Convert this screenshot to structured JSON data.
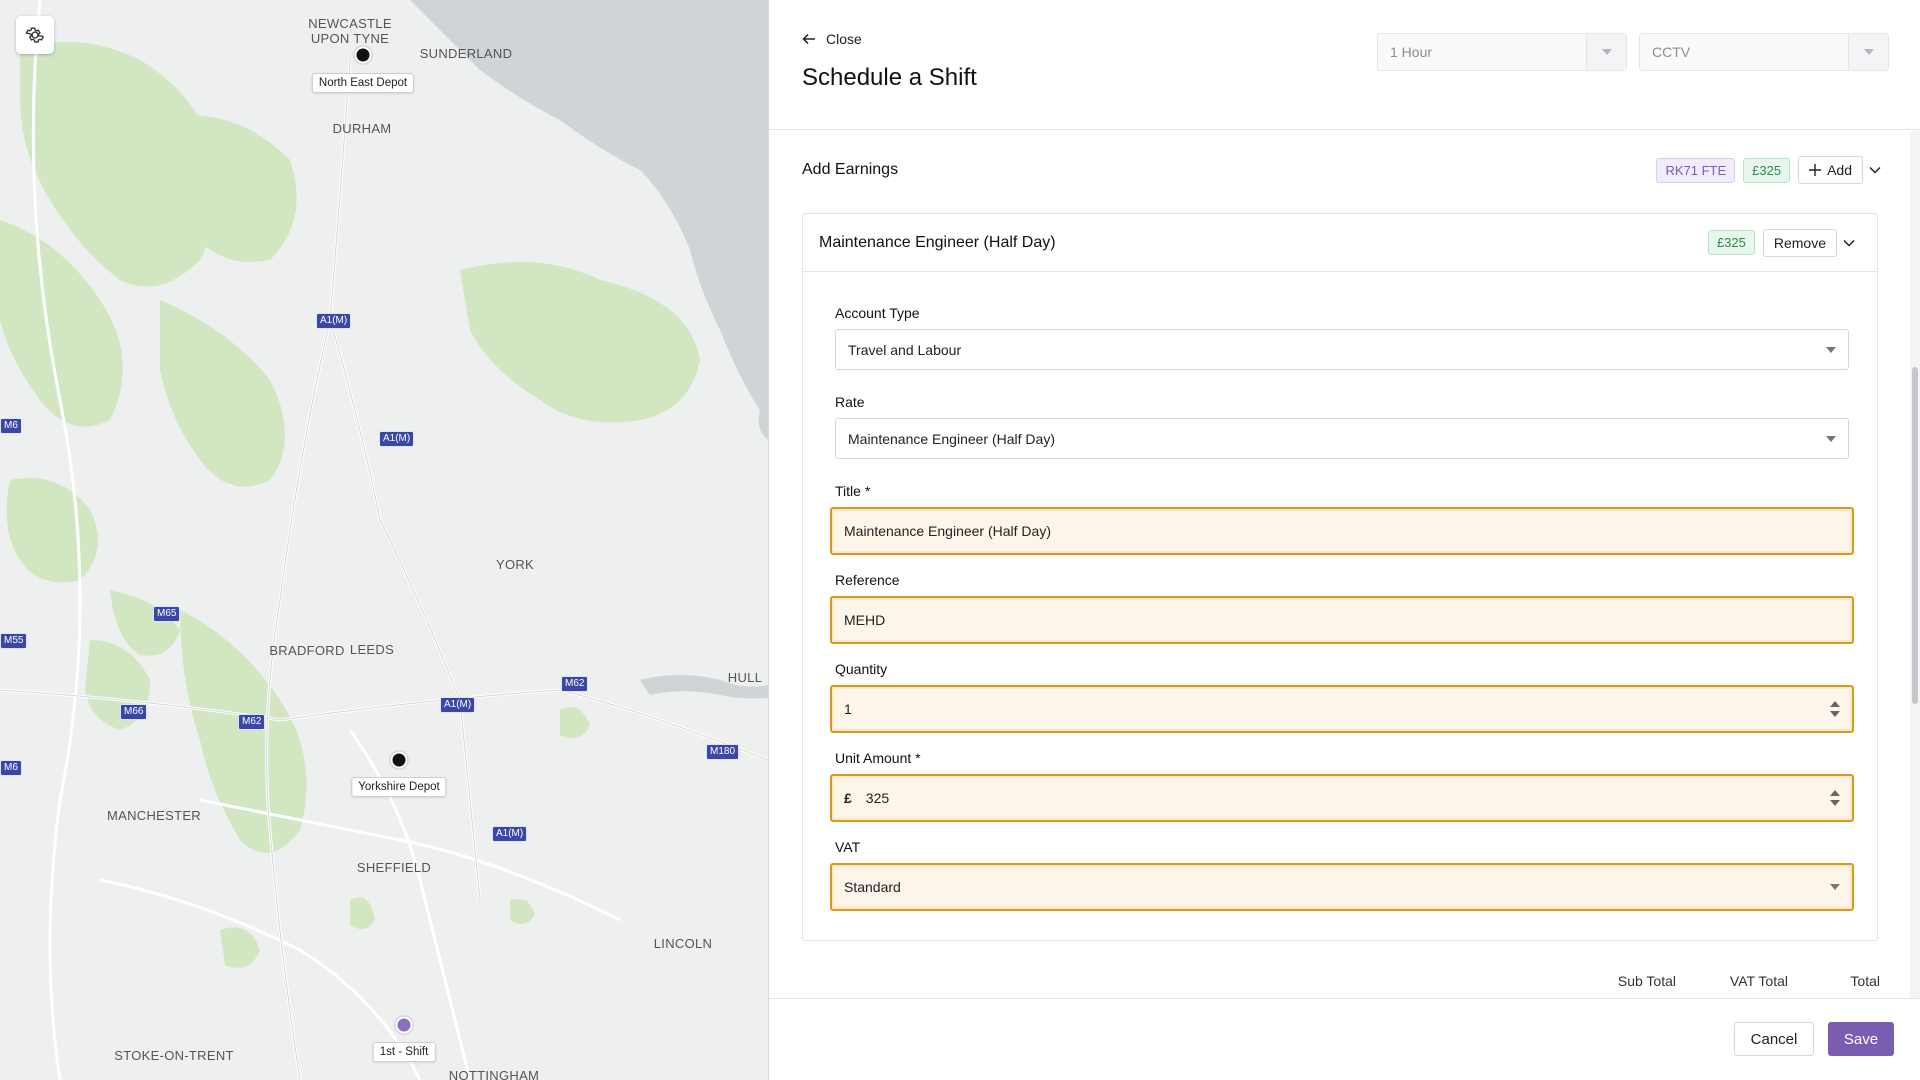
{
  "map": {
    "cities": [
      {
        "id": "newcastle",
        "label": "NEWCASTLE\nUPON TYNE"
      },
      {
        "id": "sunderland",
        "label": "SUNDERLAND"
      },
      {
        "id": "durham",
        "label": "DURHAM"
      },
      {
        "id": "york",
        "label": "YORK"
      },
      {
        "id": "bradford",
        "label": "BRADFORD"
      },
      {
        "id": "leeds",
        "label": "LEEDS"
      },
      {
        "id": "hull",
        "label": "HULL"
      },
      {
        "id": "manchester",
        "label": "MANCHESTER"
      },
      {
        "id": "sheffield",
        "label": "SHEFFIELD"
      },
      {
        "id": "lincoln",
        "label": "LINCOLN"
      },
      {
        "id": "stoke",
        "label": "STOKE-ON-TRENT"
      },
      {
        "id": "nottingham",
        "label": "NOTTINGHAM"
      }
    ],
    "roads": [
      "A1(M)",
      "A1(M)",
      "A1(M)",
      "A1(M)",
      "M6",
      "M6",
      "M65",
      "M55",
      "M66",
      "M62",
      "M62",
      "M180"
    ],
    "markers": [
      {
        "label": "North East Depot",
        "color": "#111111"
      },
      {
        "label": "Yorkshire Depot",
        "color": "#111111"
      },
      {
        "label": "1st - Shift",
        "color": "#8b6fc4"
      }
    ],
    "settings_icon": "gear-icon"
  },
  "header": {
    "close_label": "Close",
    "title": "Schedule a Shift",
    "duration_select": "1 Hour",
    "category_select": "CCTV"
  },
  "earnings": {
    "title": "Add Earnings",
    "vehicle_badge": "RK71 FTE",
    "total_badge": "£325",
    "add_label": "Add"
  },
  "item": {
    "title": "Maintenance Engineer (Half Day)",
    "amount_badge": "£325",
    "remove_label": "Remove",
    "account_type": {
      "label": "Account Type",
      "value": "Travel and Labour"
    },
    "rate": {
      "label": "Rate",
      "value": "Maintenance Engineer (Half Day)"
    },
    "title_field": {
      "label": "Title *",
      "value": "Maintenance Engineer (Half Day)"
    },
    "reference": {
      "label": "Reference",
      "value": "MEHD"
    },
    "quantity": {
      "label": "Quantity",
      "value": "1"
    },
    "unit_amount": {
      "label": "Unit Amount *",
      "currency": "£",
      "value": "325"
    },
    "vat": {
      "label": "VAT",
      "value": "Standard"
    }
  },
  "totals": {
    "sub_total_label": "Sub Total",
    "vat_total_label": "VAT Total",
    "total_label": "Total"
  },
  "footer": {
    "cancel_label": "Cancel",
    "save_label": "Save"
  },
  "colors": {
    "accent": "#7a5cb0",
    "highlight_border": "#d99a1a",
    "highlight_bg": "#fdf5ea"
  }
}
